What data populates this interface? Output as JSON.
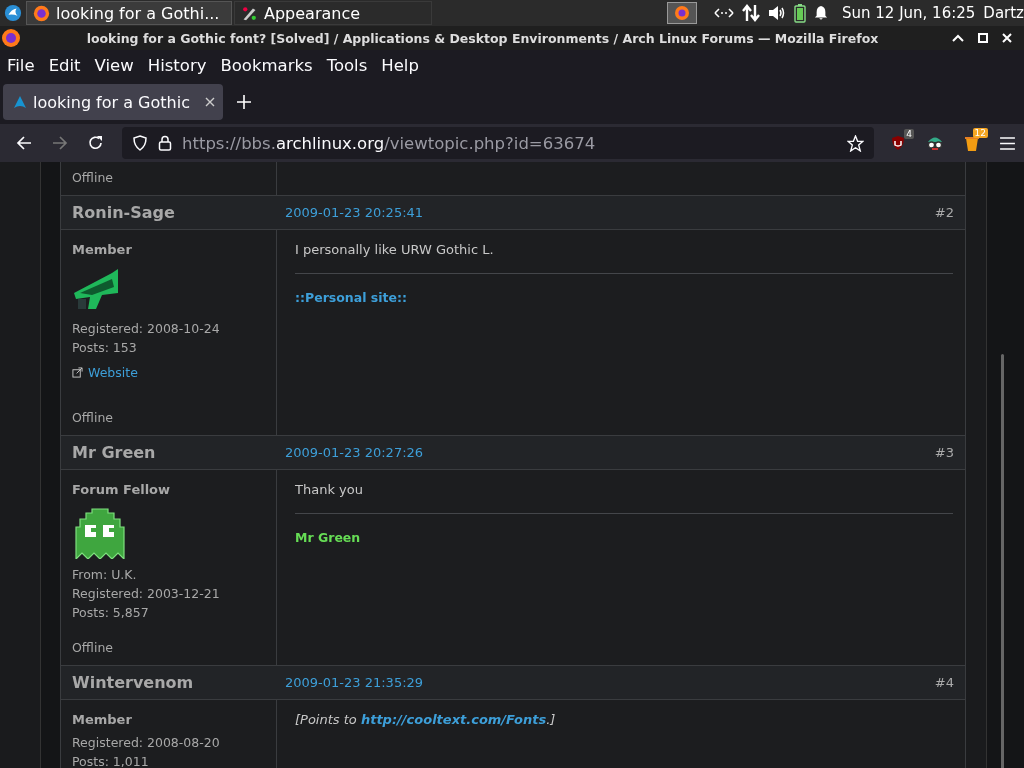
{
  "taskbar": {
    "tasks": [
      {
        "label": "looking for a Gothi...",
        "selected": true
      },
      {
        "label": "Appearance",
        "selected": false
      }
    ],
    "clock": "Sun 12 Jun, 16:25",
    "user": "Dartz"
  },
  "window": {
    "title": "looking for a Gothic font? [Solved] / Applications & Desktop Environments / Arch Linux Forums — Mozilla Firefox"
  },
  "menu": [
    "File",
    "Edit",
    "View",
    "History",
    "Bookmarks",
    "Tools",
    "Help"
  ],
  "tabs": [
    {
      "label": "looking for a Gothic",
      "selected": true
    }
  ],
  "address": {
    "prefix": "https://bbs.",
    "host": "archlinux.org",
    "path": "/viewtopic.php?id=63674"
  },
  "extensions": [
    {
      "kind": "ublock",
      "badge": "4"
    },
    {
      "kind": "glasses"
    },
    {
      "kind": "cup",
      "badge": "12"
    }
  ],
  "first_post_tail": {
    "status": "Offline"
  },
  "posts": [
    {
      "author": "Ronin-Sage",
      "date": "2009-01-23 20:25:41",
      "number": "#2",
      "rank": "Member",
      "info": [
        "Registered: 2008-10-24",
        "Posts: 153"
      ],
      "website": "Website",
      "status": "Offline",
      "message": {
        "italic": false,
        "parts": [
          {
            "kind": "text",
            "text": "I personally like URW Gothic L."
          }
        ]
      },
      "signature": {
        "kind": "link",
        "text": "::Personal site::"
      }
    },
    {
      "author": "Mr Green",
      "date": "2009-01-23 20:27:26",
      "number": "#3",
      "rank": "Forum Fellow",
      "info": [
        "From: U.K.",
        "Registered: 2003-12-21",
        "Posts: 5,857"
      ],
      "status": "Offline",
      "message": {
        "italic": false,
        "parts": [
          {
            "kind": "text",
            "text": "Thank you"
          }
        ]
      },
      "signature": {
        "kind": "colored",
        "text": "Mr Green",
        "color": "#66dd55"
      }
    },
    {
      "author": "Wintervenom",
      "date": "2009-01-23 21:35:29",
      "number": "#4",
      "rank": "Member",
      "info": [
        "Registered: 2008-08-20",
        "Posts: 1,011"
      ],
      "message": {
        "italic": true,
        "parts": [
          {
            "kind": "text",
            "text": "[Points to "
          },
          {
            "kind": "link",
            "text": "http://cooltext.com/Fonts"
          },
          {
            "kind": "text",
            "text": ".]"
          }
        ]
      }
    }
  ]
}
